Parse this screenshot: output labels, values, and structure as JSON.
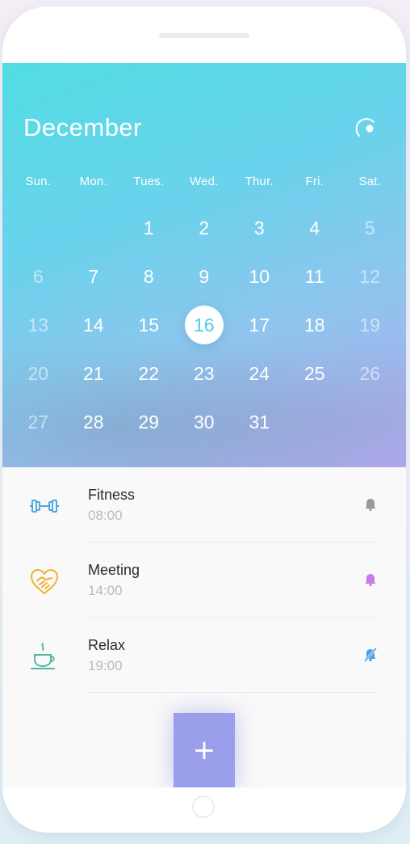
{
  "calendar": {
    "month": "December",
    "weekdays": [
      "Sun.",
      "Mon.",
      "Tues.",
      "Wed.",
      "Thur.",
      "Fri.",
      "Sat."
    ],
    "selected_day": "16",
    "weeks": [
      [
        "",
        "",
        "1",
        "2",
        "3",
        "4",
        "5"
      ],
      [
        "6",
        "7",
        "8",
        "9",
        "10",
        "11",
        "12"
      ],
      [
        "13",
        "14",
        "15",
        "16",
        "17",
        "18",
        "19"
      ],
      [
        "20",
        "21",
        "22",
        "23",
        "24",
        "25",
        "26"
      ],
      [
        "27",
        "28",
        "29",
        "30",
        "31",
        "",
        ""
      ]
    ],
    "colors": {
      "gradient_start": "#52dde4",
      "gradient_end": "#b0a8ec",
      "selected_text": "#4ecfe4"
    }
  },
  "events": [
    {
      "icon": "dumbbell-icon",
      "title": "Fitness",
      "time": "08:00",
      "reminder": "bell-icon",
      "icon_color": "#4fa8e0",
      "reminder_color": "#9a9a9a"
    },
    {
      "icon": "handshake-heart-icon",
      "title": "Meeting",
      "time": "14:00",
      "reminder": "bell-icon",
      "icon_color": "#f2b12c",
      "reminder_color": "#c47fe6"
    },
    {
      "icon": "coffee-cup-icon",
      "title": "Relax",
      "time": "19:00",
      "reminder": "bell-off-icon",
      "icon_color": "#53b7a0",
      "reminder_color": "#4a9ee0"
    }
  ],
  "add_button": {
    "label": "+",
    "color": "#9b9eea"
  }
}
